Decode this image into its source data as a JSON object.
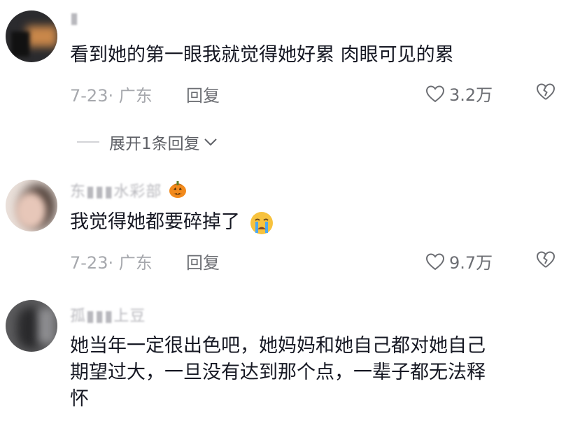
{
  "comments": [
    {
      "username": "▮",
      "text": "看到她的第一眼我就觉得她好累 肉眼可见的累",
      "date_location": "7-23· 广东",
      "reply_label": "回复",
      "likes": "3.2万"
    },
    {
      "username": "东▮▮▮水彩部",
      "text": "我觉得她都要碎掉了",
      "date_location": "7-23· 广东",
      "reply_label": "回复",
      "likes": "9.7万"
    },
    {
      "username": "孤▮▮▮上豆",
      "text_line1": "她当年一定很出色吧，她妈妈和她自己都对她自己",
      "text_line2": "期望过大，一旦没有达到那个点，一辈子都无法释",
      "text_line3": "怀"
    }
  ],
  "expand_replies": "展开1条回复",
  "icons": {
    "like": "heart-outline-icon",
    "dislike": "broken-heart-icon",
    "expand": "chevron-down-icon",
    "emoji_pumpkin": "pumpkin-emoji",
    "emoji_crying": "crying-face-emoji"
  }
}
